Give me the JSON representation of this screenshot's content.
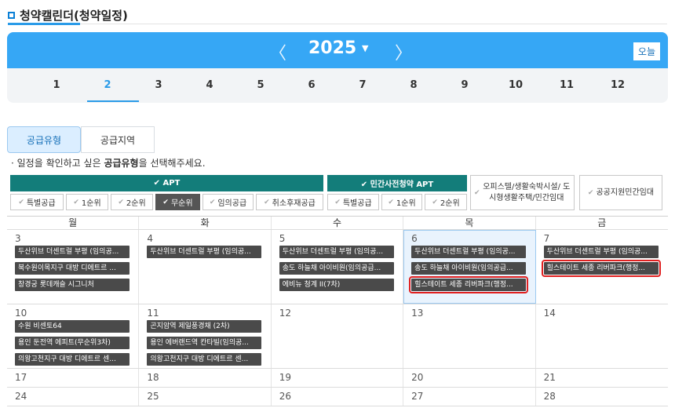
{
  "page": {
    "title": "청약캘린더(청약일정)"
  },
  "calendar_bar": {
    "prev": "〈",
    "year": "2025",
    "caret": "▼",
    "next": "〉",
    "today_label": "오늘"
  },
  "months": [
    "1",
    "2",
    "3",
    "4",
    "5",
    "6",
    "7",
    "8",
    "9",
    "10",
    "11",
    "12"
  ],
  "active_month": "2",
  "tabs": {
    "supply_type": "공급유형",
    "supply_region": "공급지역"
  },
  "notice": {
    "prefix": "· 일정을 확인하고 싶은 ",
    "bold": "공급유형",
    "suffix": "을 선택해주세요."
  },
  "filters": {
    "apt_head": "✔ APT",
    "private_head": "✔ 민간사전청약 APT",
    "apt": [
      "특별공급",
      "1순위",
      "2순위",
      "무순위",
      "임의공급",
      "취소후재공급"
    ],
    "private": [
      "특별공급",
      "1순위",
      "2순위"
    ],
    "officetel": "오피스텔/생활숙박시설/ 도시형생활주택/민간임대",
    "public_rental": "공공지원민간임대",
    "check": "✔"
  },
  "weekdays": [
    "월",
    "화",
    "수",
    "목",
    "금"
  ],
  "weeks": [
    {
      "days": [
        {
          "num": "3",
          "events": [
            "두산위브 더센트럴 부평 (임의공...",
            "북수원이목지구 대방 디에트르 ...",
            "창경궁 롯데캐슬 시그니처"
          ]
        },
        {
          "num": "4",
          "events": [
            "두산위브 더센트럴 부평 (임의공..."
          ]
        },
        {
          "num": "5",
          "events": [
            "두산위브 더센트럴 부평 (임의공...",
            "송도 하늘채 아이비원(임의공급...",
            "에비뉴 청계 II(7차)"
          ]
        },
        {
          "num": "6",
          "events": [
            "두산위브 더센트럴 부평 (임의공...",
            "송도 하늘채 아이비원(임의공급...",
            "힐스테이트 세종 리버파크(행정..."
          ]
        },
        {
          "num": "7",
          "events": [
            "두산위브 더센트럴 부평 (임의공...",
            "힐스테이트 세종 리버파크(행정..."
          ]
        }
      ]
    },
    {
      "days": [
        {
          "num": "10",
          "events": [
            "수원 비센토64",
            "용인 둔전역 에피트(무순위3차)",
            "의왕고천지구 대방 디에트르 센..."
          ]
        },
        {
          "num": "11",
          "events": [
            "곤지암역 제일풍경채 (2차)",
            "용인 에버랜드역 칸타빌(임의공...",
            "의왕고천지구 대방 디에트르 센..."
          ]
        },
        {
          "num": "12",
          "events": []
        },
        {
          "num": "13",
          "events": []
        },
        {
          "num": "14",
          "events": []
        }
      ]
    },
    {
      "days": [
        {
          "num": "17",
          "events": []
        },
        {
          "num": "18",
          "events": []
        },
        {
          "num": "19",
          "events": []
        },
        {
          "num": "20",
          "events": []
        },
        {
          "num": "21",
          "events": []
        }
      ]
    },
    {
      "days": [
        {
          "num": "24",
          "events": []
        },
        {
          "num": "25",
          "events": []
        },
        {
          "num": "26",
          "events": []
        },
        {
          "num": "27",
          "events": []
        },
        {
          "num": "28",
          "events": []
        }
      ]
    }
  ]
}
